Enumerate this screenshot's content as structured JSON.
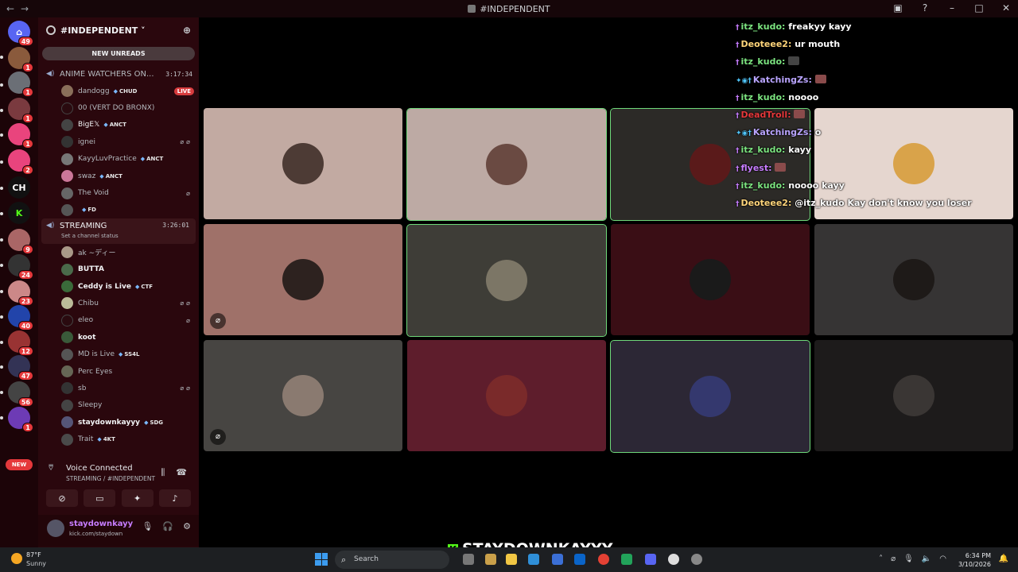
{
  "window": {
    "title": "#INDEPENDENT"
  },
  "rail": {
    "badges": [
      "49",
      "1",
      "1",
      "1",
      "1",
      "2",
      "9",
      "24",
      "23",
      "40",
      "12",
      "47",
      "56",
      "1"
    ],
    "new_label": "NEW"
  },
  "guild": {
    "name": "#INDEPENDENT",
    "new_unreads": "NEW UNREADS"
  },
  "channels": [
    {
      "name": "ANIME WATCHERS ON...",
      "timer": "3:17:34"
    },
    {
      "name": "STREAMING",
      "timer": "3:26:01",
      "status": "Set a channel status"
    }
  ],
  "anime_users": [
    {
      "name": "dandogg",
      "tag": "CHUD",
      "live": "LIVE"
    },
    {
      "name": "00 (VERT DO BRONX)",
      "tag": ""
    },
    {
      "name": "BigE𝕏",
      "tag": "ANCT"
    },
    {
      "name": "ignei",
      "tag": ""
    },
    {
      "name": "KayyLuvPractice",
      "tag": "ANCT"
    },
    {
      "name": "swaz",
      "tag": "ANCT"
    },
    {
      "name": "The Void",
      "tag": ""
    },
    {
      "name": "",
      "tag": "FD"
    }
  ],
  "streaming_users": [
    {
      "name": "ak ∼ディー",
      "tag": ""
    },
    {
      "name": "BUTTA",
      "tag": ""
    },
    {
      "name": "Ceddy is Live",
      "tag": "CTF"
    },
    {
      "name": "Chibu",
      "tag": ""
    },
    {
      "name": "eleo",
      "tag": ""
    },
    {
      "name": "koot",
      "tag": ""
    },
    {
      "name": "MD is Live",
      "tag": "SS4L"
    },
    {
      "name": "Perc Eyes",
      "tag": ""
    },
    {
      "name": "sb",
      "tag": ""
    },
    {
      "name": "Sleepy",
      "tag": ""
    },
    {
      "name": "staydownkayyy",
      "tag": "SDG"
    },
    {
      "name": "Trait",
      "tag": "4KT"
    }
  ],
  "voice": {
    "status": "Voice Connected",
    "location": "STREAMING / #INDEPENDENT"
  },
  "user": {
    "name": "staydownkayy",
    "status": "kick.com/staydown"
  },
  "chat": [
    {
      "user": "itz_kudo:",
      "text": "freakyy kayy",
      "color": "#7be37f"
    },
    {
      "user": "Deoteee2:",
      "text": "ur mouth",
      "color": "#ffd57a"
    },
    {
      "user": "itz_kudo:",
      "text": "",
      "color": "#7be37f"
    },
    {
      "user": "KatchingZs:",
      "text": "",
      "color": "#b9a4ff"
    },
    {
      "user": "itz_kudo:",
      "text": "noooo",
      "color": "#7be37f"
    },
    {
      "user": "DeadTroll:",
      "text": "",
      "color": "#e5383b"
    },
    {
      "user": "KatchingZs:",
      "text": "o",
      "color": "#b9a4ff"
    },
    {
      "user": "itz_kudo:",
      "text": "kayy",
      "color": "#7be37f"
    },
    {
      "user": "flyest:",
      "text": "",
      "color": "#c77dff"
    },
    {
      "user": "itz_kudo:",
      "text": "noooo kayy",
      "color": "#7be37f"
    },
    {
      "user": "Deoteee2:",
      "text": "@itz_kudo Kay don't know you loser",
      "color": "#ffd57a"
    }
  ],
  "watermark": "STAYDOWNKAYYY",
  "taskbar": {
    "temp": "87°F",
    "condition": "Sunny",
    "search": "Search",
    "time": "6:34 PM",
    "date": "3/10/2026"
  }
}
